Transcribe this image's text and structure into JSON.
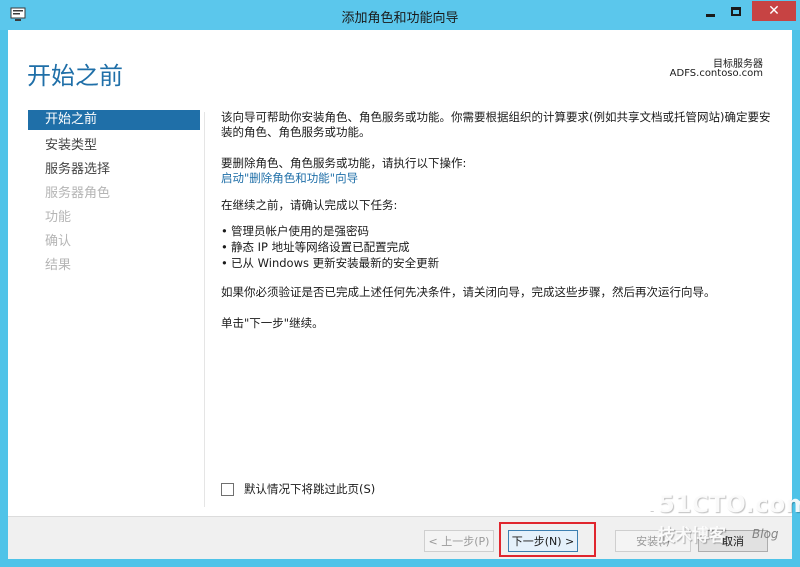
{
  "window": {
    "title": "添加角色和功能向导",
    "close_glyph": "✕"
  },
  "header": {
    "page_title": "开始之前",
    "target_label": "目标服务器",
    "target_value": "ADFS.contoso.com"
  },
  "nav": {
    "items": [
      {
        "label": "开始之前",
        "state": "active"
      },
      {
        "label": "安装类型",
        "state": "enabled"
      },
      {
        "label": "服务器选择",
        "state": "enabled"
      },
      {
        "label": "服务器角色",
        "state": "disabled"
      },
      {
        "label": "功能",
        "state": "disabled"
      },
      {
        "label": "确认",
        "state": "disabled"
      },
      {
        "label": "结果",
        "state": "disabled"
      }
    ]
  },
  "content": {
    "intro": "该向导可帮助你安装角色、角色服务或功能。你需要根据组织的计算要求(例如共享文档或托管网站)确定要安装的角色、角色服务或功能。",
    "remove_prompt": "要删除角色、角色服务或功能，请执行以下操作:",
    "remove_link": "启动\"删除角色和功能\"向导",
    "before_continue": "在继续之前，请确认完成以下任务:",
    "tasks": [
      "管理员帐户使用的是强密码",
      "静态 IP 地址等网络设置已配置完成",
      "已从 Windows 更新安装最新的安全更新"
    ],
    "bullet_glyph": "•",
    "prereq_note": "如果你必须验证是否已完成上述任何先决条件，请关闭向导，完成这些步骤，然后再次运行向导。",
    "next_note": "单击\"下一步\"继续。"
  },
  "skip": {
    "label": "默认情况下将跳过此页(S)"
  },
  "buttons": {
    "prev": "< 上一步(P)",
    "next": "下一步(N) >",
    "install": "安装(I)",
    "cancel": "取消"
  },
  "watermark": {
    "site": "51CTO.com",
    "tagline": "技术博客",
    "blog": "Blog",
    "dash": "-"
  },
  "colors": {
    "titlebar": "#5bc7ec",
    "accent": "#1f6fa8",
    "close_button": "#c74343",
    "highlight": "#e0262e"
  }
}
